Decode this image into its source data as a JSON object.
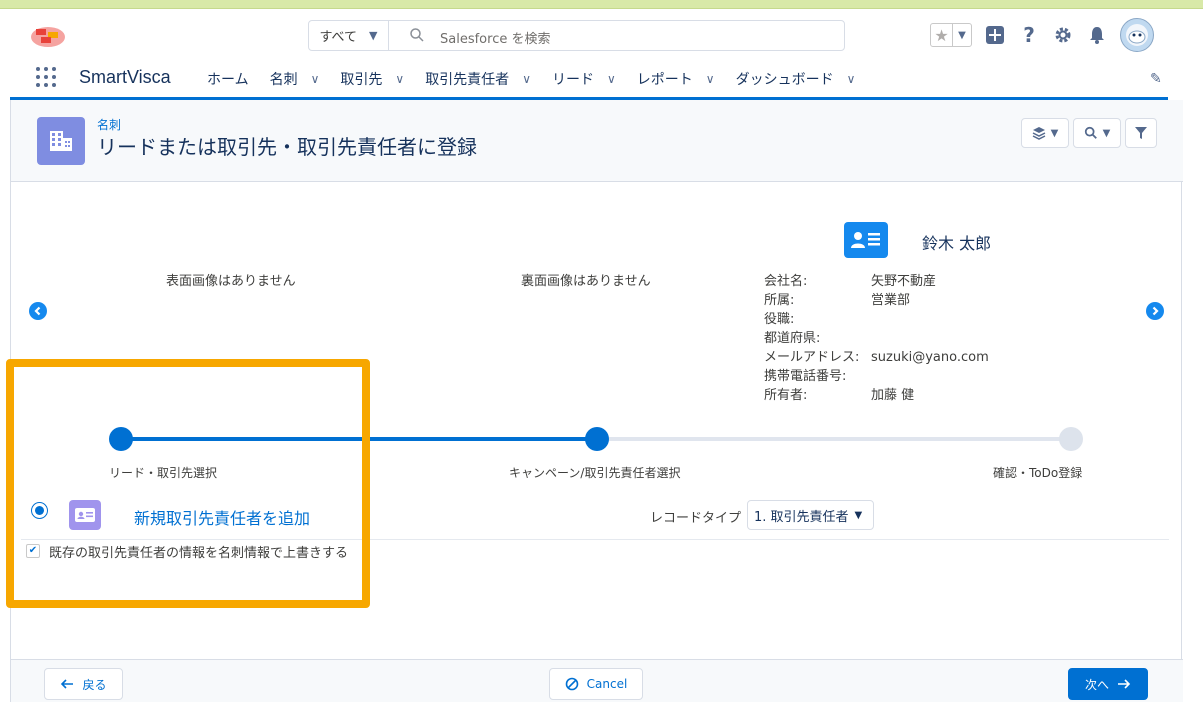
{
  "header": {
    "search_scope": "すべて",
    "search_placeholder": "Salesforce を検索"
  },
  "nav": {
    "app_name": "SmartVisca",
    "items": [
      {
        "label": "ホーム",
        "has_menu": false
      },
      {
        "label": "名刺",
        "has_menu": true
      },
      {
        "label": "取引先",
        "has_menu": true
      },
      {
        "label": "取引先責任者",
        "has_menu": true
      },
      {
        "label": "リード",
        "has_menu": true
      },
      {
        "label": "レポート",
        "has_menu": true
      },
      {
        "label": "ダッシュボード",
        "has_menu": true
      }
    ]
  },
  "page": {
    "object_label": "名刺",
    "title": "リードまたは取引先・取引先責任者に登録"
  },
  "card": {
    "front_image_text": "表面画像はありません",
    "back_image_text": "裏面画像はありません",
    "name": "鈴木 太郎",
    "fields": [
      {
        "label": "会社名:",
        "value": "矢野不動産"
      },
      {
        "label": "所属:",
        "value": "営業部"
      },
      {
        "label": "役職:",
        "value": ""
      },
      {
        "label": "都道府県:",
        "value": ""
      },
      {
        "label": "メールアドレス:",
        "value": "suzuki@yano.com"
      },
      {
        "label": "携帯電話番号:",
        "value": ""
      },
      {
        "label": "所有者:",
        "value": "加藤 健"
      }
    ]
  },
  "path": {
    "steps": [
      {
        "label": "リード・取引先選択",
        "state": "done"
      },
      {
        "label": "キャンペーン/取引先責任者選択",
        "state": "current"
      },
      {
        "label": "確認・ToDo登録",
        "state": "todo"
      }
    ]
  },
  "options": {
    "new_contact_label": "新規取引先責任者を追加",
    "new_contact_selected": true,
    "record_type_label": "レコードタイプ",
    "record_type_value": "1. 取引先責任者",
    "overwrite_label": "既存の取引先責任者の情報を名刺情報で上書きする",
    "overwrite_checked": true
  },
  "footer": {
    "back_label": "戻る",
    "cancel_label": "Cancel",
    "next_label": "次へ"
  },
  "colors": {
    "brand": "#0070d2",
    "highlight": "#f7a700",
    "object_icon": "#7f8de1",
    "contact_icon": "#1589ee",
    "new_contact_icon": "#a094ed"
  },
  "icons": [
    "salesforce-cloud-icon",
    "search-icon",
    "star-icon",
    "add-icon",
    "help-icon",
    "gear-icon",
    "bell-icon",
    "avatar",
    "app-launcher-icon",
    "edit-pencil-icon",
    "building-icon",
    "layers-icon",
    "filter-icon",
    "contact-card-icon",
    "arrow-left-icon",
    "arrow-right-icon",
    "cancel-icon"
  ]
}
